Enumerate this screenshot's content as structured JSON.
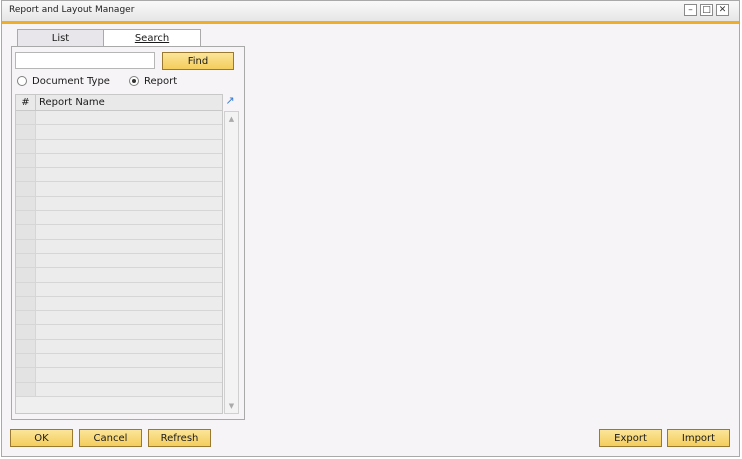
{
  "window": {
    "title": "Report and Layout Manager"
  },
  "tabs": [
    {
      "label": "List"
    },
    {
      "label": "Search"
    }
  ],
  "search": {
    "input_value": "",
    "find_label": "Find"
  },
  "radios": {
    "document_type": {
      "label": "Document Type",
      "checked": false
    },
    "report": {
      "label": "Report",
      "checked": true
    }
  },
  "grid": {
    "columns": [
      "#",
      "Report Name"
    ],
    "rows": [
      [
        "",
        ""
      ],
      [
        "",
        ""
      ],
      [
        "",
        ""
      ],
      [
        "",
        ""
      ],
      [
        "",
        ""
      ],
      [
        "",
        ""
      ],
      [
        "",
        ""
      ],
      [
        "",
        ""
      ],
      [
        "",
        ""
      ],
      [
        "",
        ""
      ],
      [
        "",
        ""
      ],
      [
        "",
        ""
      ],
      [
        "",
        ""
      ],
      [
        "",
        ""
      ],
      [
        "",
        ""
      ],
      [
        "",
        ""
      ],
      [
        "",
        ""
      ],
      [
        "",
        ""
      ],
      [
        "",
        ""
      ],
      [
        "",
        ""
      ]
    ]
  },
  "buttons": {
    "ok": "OK",
    "cancel": "Cancel",
    "refresh": "Refresh",
    "export": "Export",
    "import": "Import"
  },
  "colors": {
    "accent": "#f0ad2a",
    "button": "#f4cd5c"
  },
  "icons": {
    "minimize": "minimize-icon",
    "maximize": "maximize-icon",
    "close": "close-icon",
    "expand": "expand-icon",
    "scroll_up": "scroll-up-icon",
    "scroll_down": "scroll-down-icon"
  }
}
